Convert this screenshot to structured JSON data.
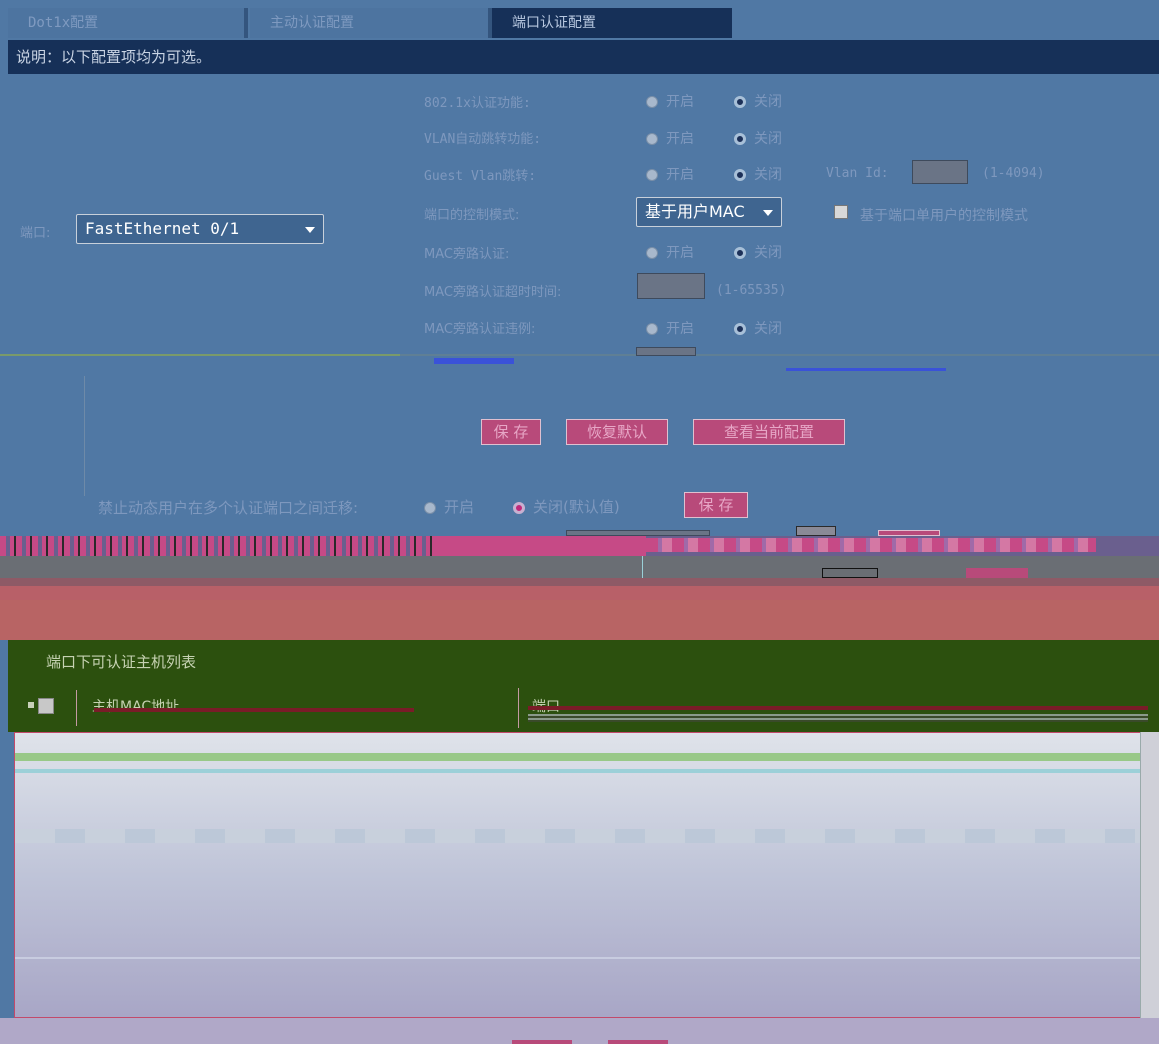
{
  "tabs": [
    {
      "label": "Dot1x配置",
      "active": false
    },
    {
      "label": "主动认证配置",
      "active": false
    },
    {
      "label": "端口认证配置",
      "active": true
    }
  ],
  "banner": {
    "text": "说明：以下配置项均为可选。"
  },
  "port": {
    "label": "端口:",
    "value": "FastEthernet 0/1"
  },
  "option_labels": {
    "on": "开启",
    "off": "关闭"
  },
  "settings": {
    "dot1x_label": "802.1x认证功能:",
    "vlan_jump_label": "VLAN自动跳转功能:",
    "guest_vlan_label": "Guest Vlan跳转:",
    "vlan_id_label": "Vlan Id:",
    "vlan_id_range": "(1-4094)",
    "control_mode_label": "端口的控制模式:",
    "control_mode_value": "基于用户MAC",
    "single_user_label": "基于端口单用户的控制模式",
    "mac_bypass_label": "MAC旁路认证:",
    "mac_bypass_timeout_label": "MAC旁路认证超时时间:",
    "mac_bypass_timeout_range": "(1-65535)",
    "mac_bypass_exception_label": "MAC旁路认证违例:"
  },
  "buttons": {
    "save": "保 存",
    "restore": "恢复默认",
    "view_current": "查看当前配置"
  },
  "migrate": {
    "label": "禁止动态用户在多个认证端口之间迁移:",
    "on": "开启",
    "off": "关闭(默认值)",
    "save": "保 存"
  },
  "host_list": {
    "title": "端口下可认证主机列表",
    "col_mac": "主机MAC地址",
    "col_port": "端口"
  },
  "colors": {
    "background": "#5078a4",
    "banner": "#163058",
    "button": "#b84a7a",
    "panel": "#2c500e"
  }
}
